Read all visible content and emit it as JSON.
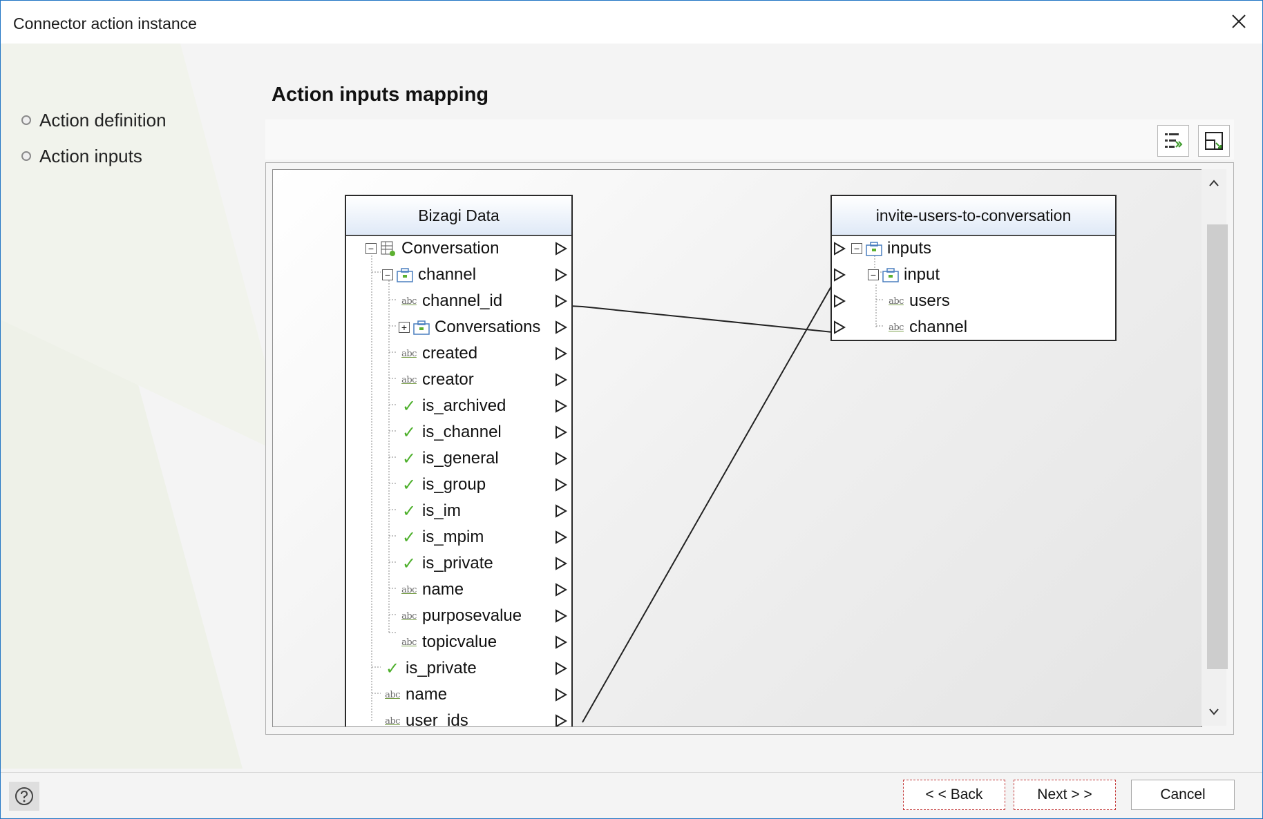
{
  "window": {
    "title": "Connector action instance"
  },
  "steps": [
    {
      "label": "Action definition"
    },
    {
      "label": "Action inputs"
    }
  ],
  "main": {
    "heading": "Action inputs mapping"
  },
  "left_panel": {
    "title": "Bizagi Data",
    "nodes": [
      {
        "label": "Conversation",
        "icon": "entity-icon"
      },
      {
        "label": "channel",
        "icon": "object-icon"
      },
      {
        "label": "channel_id",
        "icon": "string-icon"
      },
      {
        "label": "Conversations",
        "icon": "object-icon"
      },
      {
        "label": "created",
        "icon": "string-icon"
      },
      {
        "label": "creator",
        "icon": "string-icon"
      },
      {
        "label": "is_archived",
        "icon": "boolean-icon"
      },
      {
        "label": "is_channel",
        "icon": "boolean-icon"
      },
      {
        "label": "is_general",
        "icon": "boolean-icon"
      },
      {
        "label": "is_group",
        "icon": "boolean-icon"
      },
      {
        "label": "is_im",
        "icon": "boolean-icon"
      },
      {
        "label": "is_mpim",
        "icon": "boolean-icon"
      },
      {
        "label": "is_private",
        "icon": "boolean-icon"
      },
      {
        "label": "name",
        "icon": "string-icon"
      },
      {
        "label": "purposevalue",
        "icon": "string-icon"
      },
      {
        "label": "topicvalue",
        "icon": "string-icon"
      },
      {
        "label": "is_private",
        "icon": "boolean-icon"
      },
      {
        "label": "name",
        "icon": "string-icon"
      },
      {
        "label": "user_ids",
        "icon": "string-icon"
      }
    ]
  },
  "right_panel": {
    "title": "invite-users-to-conversation",
    "nodes": [
      {
        "label": "inputs",
        "icon": "object-icon"
      },
      {
        "label": "input",
        "icon": "object-icon"
      },
      {
        "label": "users",
        "icon": "string-icon"
      },
      {
        "label": "channel",
        "icon": "string-icon"
      }
    ]
  },
  "icons": {
    "string_glyph": "abc",
    "check_glyph": "✓",
    "expand_glyph": "+",
    "collapse_glyph": "−"
  },
  "mappings": [
    {
      "from": "channel_id",
      "to": "channel"
    },
    {
      "from": "user_ids",
      "to": "users"
    }
  ],
  "buttons": {
    "back": "< < Back",
    "next": "Next > >",
    "cancel": "Cancel"
  },
  "colors": {
    "accent": "#1f74c4",
    "check": "#4caf2a",
    "header_gradient_end": "#dfe9f7"
  }
}
